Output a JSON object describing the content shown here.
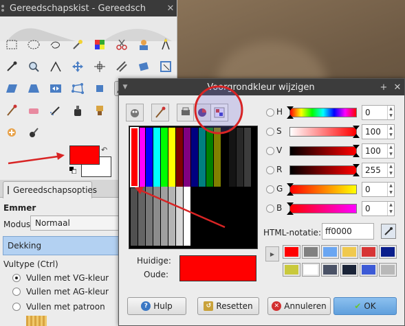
{
  "toolbox": {
    "title": "Gereedschapskist - Gereedsch",
    "tools": [
      "rect-select",
      "ellipse-select",
      "free-select",
      "fuzzy-select",
      "color-select",
      "scissors",
      "foreground-select",
      "paths",
      "color-picker",
      "zoom",
      "measure",
      "move",
      "align",
      "crop",
      "rotate",
      "scale",
      "shear",
      "perspective",
      "flip",
      "cage",
      "unified-transform",
      "warp",
      "text",
      "bucket-fill",
      "blend",
      "pencil",
      "paintbrush",
      "eraser",
      "airbrush",
      "ink",
      "clone",
      "heal",
      "perspective-clone",
      "blur",
      "smudge",
      "dodge"
    ],
    "fg_color": "#ff0000",
    "bg_color": "#ffffff"
  },
  "options": {
    "tab_label": "Gereedschapsopties",
    "heading": "Emmer",
    "modus_label": "Modus:",
    "modus_value": "Normaal",
    "dekking_label": "Dekking",
    "vultype_label": "Vultype (Ctrl)",
    "fill_options": [
      {
        "label": "Vullen met VG-kleur",
        "checked": true
      },
      {
        "label": "Vullen met AG-kleur",
        "checked": false
      },
      {
        "label": "Vullen met patroon",
        "checked": false
      }
    ]
  },
  "dialog": {
    "title": "Voorgrondkleur wijzigen",
    "selector_tabs": [
      "gimp-selector",
      "watercolor-selector",
      "cmyk-selector",
      "color-wheel",
      "palette-selector"
    ],
    "active_selector": "palette-selector",
    "channels": [
      {
        "label": "H",
        "value": "0"
      },
      {
        "label": "S",
        "value": "100"
      },
      {
        "label": "V",
        "value": "100"
      },
      {
        "label": "R",
        "value": "255"
      },
      {
        "label": "G",
        "value": "0"
      },
      {
        "label": "B",
        "value": "0"
      }
    ],
    "html_label": "HTML-notatie:",
    "html_value": "ff0000",
    "current_label": "Huidige:",
    "old_label": "Oude:",
    "current_color": "#ff0000",
    "old_color": "#ff0000",
    "history_colors": [
      "#ff0000",
      "#808080",
      "#6aa6f2",
      "#f0c94e",
      "#d73535",
      "#0a1e8c",
      "#c9c93c",
      "#ffffff",
      "#4a5266",
      "#1a2438",
      "#3c5ad6",
      "#b8b8b8"
    ],
    "buttons": {
      "help": "Hulp",
      "reset": "Resetten",
      "cancel": "Annuleren",
      "ok": "OK"
    }
  },
  "accent_colors": {
    "annotation": "#e02020",
    "highlight_circle": "#7a6ad8"
  }
}
